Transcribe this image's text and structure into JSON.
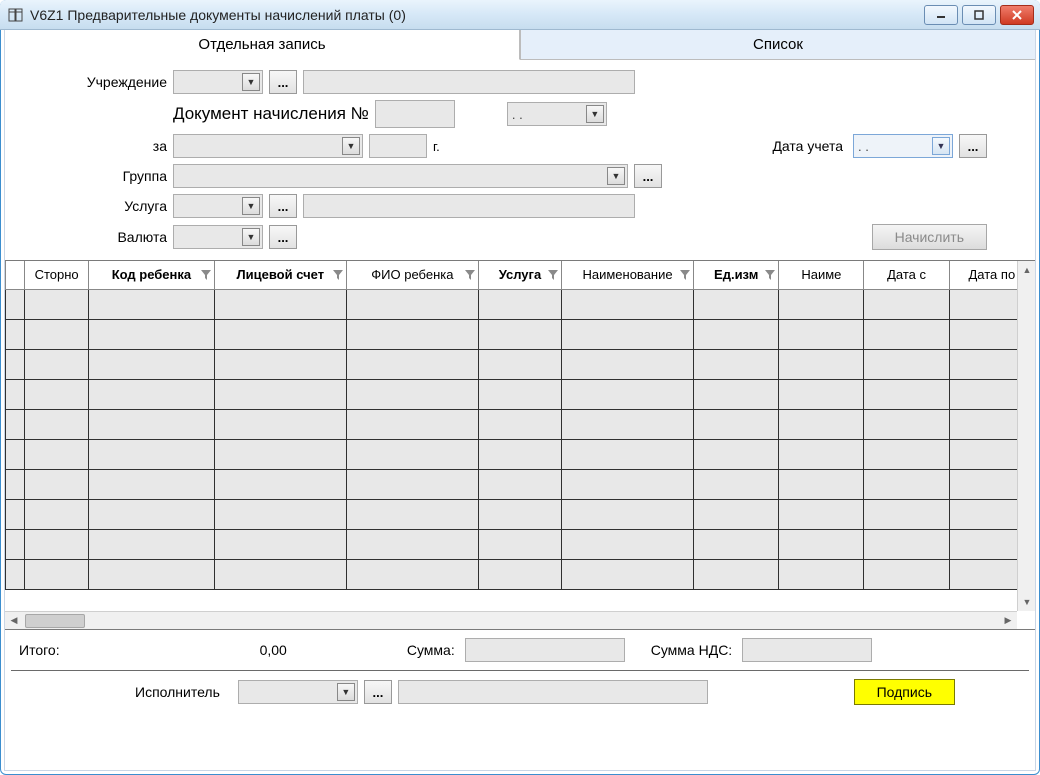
{
  "window": {
    "title": "V6Z1 Предварительные документы начислений платы (0)"
  },
  "tabs": {
    "single": "Отдельная запись",
    "list": "Список"
  },
  "form": {
    "institution_label": "Учреждение",
    "doc_number_label": "Документ начисления №",
    "doc_number_value": "",
    "doc_date_value": ". .",
    "period_label": "за",
    "period_year_value": "",
    "period_year_suffix": "г.",
    "accounting_date_label": "Дата учета",
    "accounting_date_value": ". .",
    "group_label": "Группа",
    "service_label": "Услуга",
    "currency_label": "Валюта",
    "calc_button": "Начислить"
  },
  "grid": {
    "columns": [
      {
        "label": "",
        "bold": false,
        "filter": false,
        "w": 18
      },
      {
        "label": "Сторно",
        "bold": false,
        "filter": false,
        "w": 60
      },
      {
        "label": "Код ребенка",
        "bold": true,
        "filter": true,
        "w": 118
      },
      {
        "label": "Лицевой счет",
        "bold": true,
        "filter": true,
        "w": 124
      },
      {
        "label": "ФИО ребенка",
        "bold": false,
        "filter": true,
        "w": 124
      },
      {
        "label": "Услуга",
        "bold": true,
        "filter": true,
        "w": 78
      },
      {
        "label": "Наименование",
        "bold": false,
        "filter": true,
        "w": 124
      },
      {
        "label": "Ед.изм",
        "bold": true,
        "filter": true,
        "w": 80
      },
      {
        "label": "Наиме",
        "bold": false,
        "filter": false,
        "w": 80
      },
      {
        "label": "Дата с",
        "bold": false,
        "filter": false,
        "w": 80
      },
      {
        "label": "Дата по",
        "bold": false,
        "filter": false,
        "w": 80
      }
    ],
    "empty_rows": 10
  },
  "totals": {
    "total_label": "Итого:",
    "total_value": "0,00",
    "sum_label": "Сумма:",
    "sum_value": "",
    "vat_label": "Сумма НДС:",
    "vat_value": ""
  },
  "footer": {
    "executor_label": "Исполнитель",
    "sign_button": "Подпись"
  }
}
